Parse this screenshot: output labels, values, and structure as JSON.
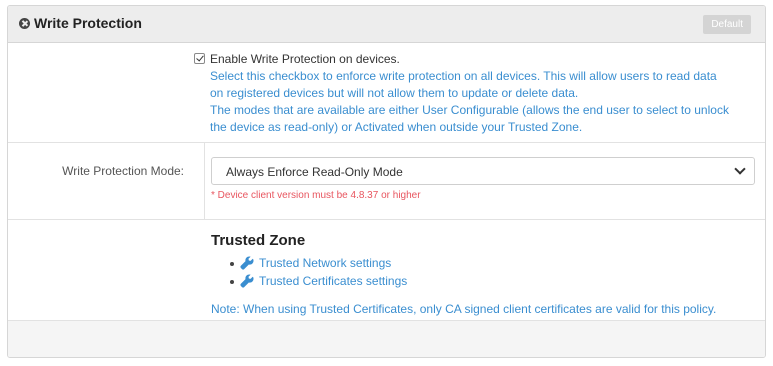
{
  "header": {
    "title": "Write Protection",
    "default_label": "Default"
  },
  "enable": {
    "checked": true,
    "label": "Enable Write Protection on devices.",
    "description_lines": [
      "Select this checkbox to enforce write protection on all devices. This will allow users to read data",
      "on registered devices but will not allow them to update or delete data.",
      "The modes that are available are either User Configurable (allows the end user to select to unlock",
      "the device as read-only) or Activated when outside your Trusted Zone."
    ]
  },
  "mode": {
    "label": "Write Protection Mode:",
    "selected": "Always Enforce Read-Only Mode",
    "warning": "* Device client version must be 4.8.37 or higher"
  },
  "trusted_zone": {
    "title": "Trusted Zone",
    "links": [
      {
        "label": "Trusted Network settings",
        "icon": "wrench-icon"
      },
      {
        "label": "Trusted Certificates settings",
        "icon": "wrench-icon"
      }
    ],
    "note": "Note: When using Trusted Certificates, only CA signed client certificates are valid for this policy."
  },
  "colors": {
    "link": "#3a8ed0",
    "warning": "#e8555f",
    "header_bg": "#ededed"
  }
}
